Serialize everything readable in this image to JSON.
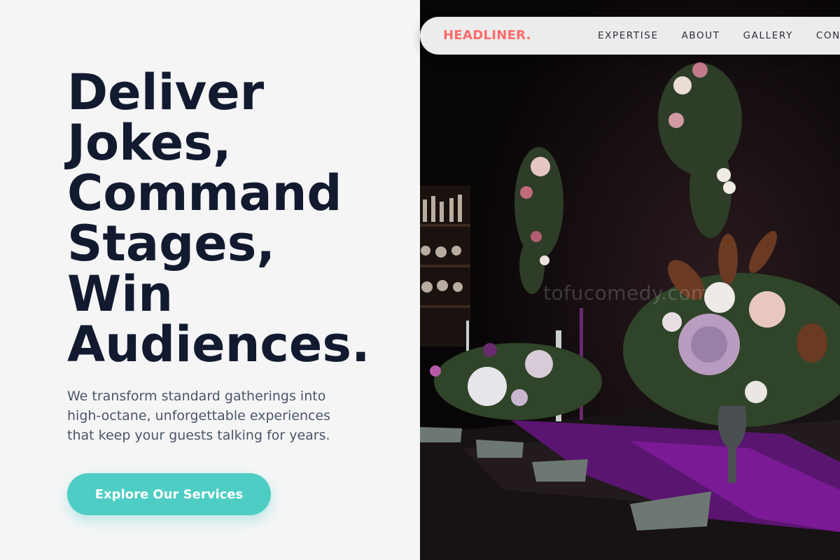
{
  "hero": {
    "headline_lines": [
      "Deliver",
      "Jokes,",
      "Command",
      "Stages,",
      "Win",
      "Audiences."
    ],
    "subtext": "We transform standard gatherings into high-octane, unforgettable experiences that keep your guests talking for years.",
    "cta_label": "Explore Our Services"
  },
  "navbar": {
    "logo": "HEADLINER.",
    "links": [
      "EXPERTISE",
      "ABOUT",
      "GALLERY",
      "CON"
    ]
  },
  "image": {
    "watermark": "tofucomedy.com"
  },
  "colors": {
    "accent": "#4ecdc4",
    "brand": "#ff6b6b",
    "heading": "#121a30",
    "body_text": "#4b5567"
  }
}
